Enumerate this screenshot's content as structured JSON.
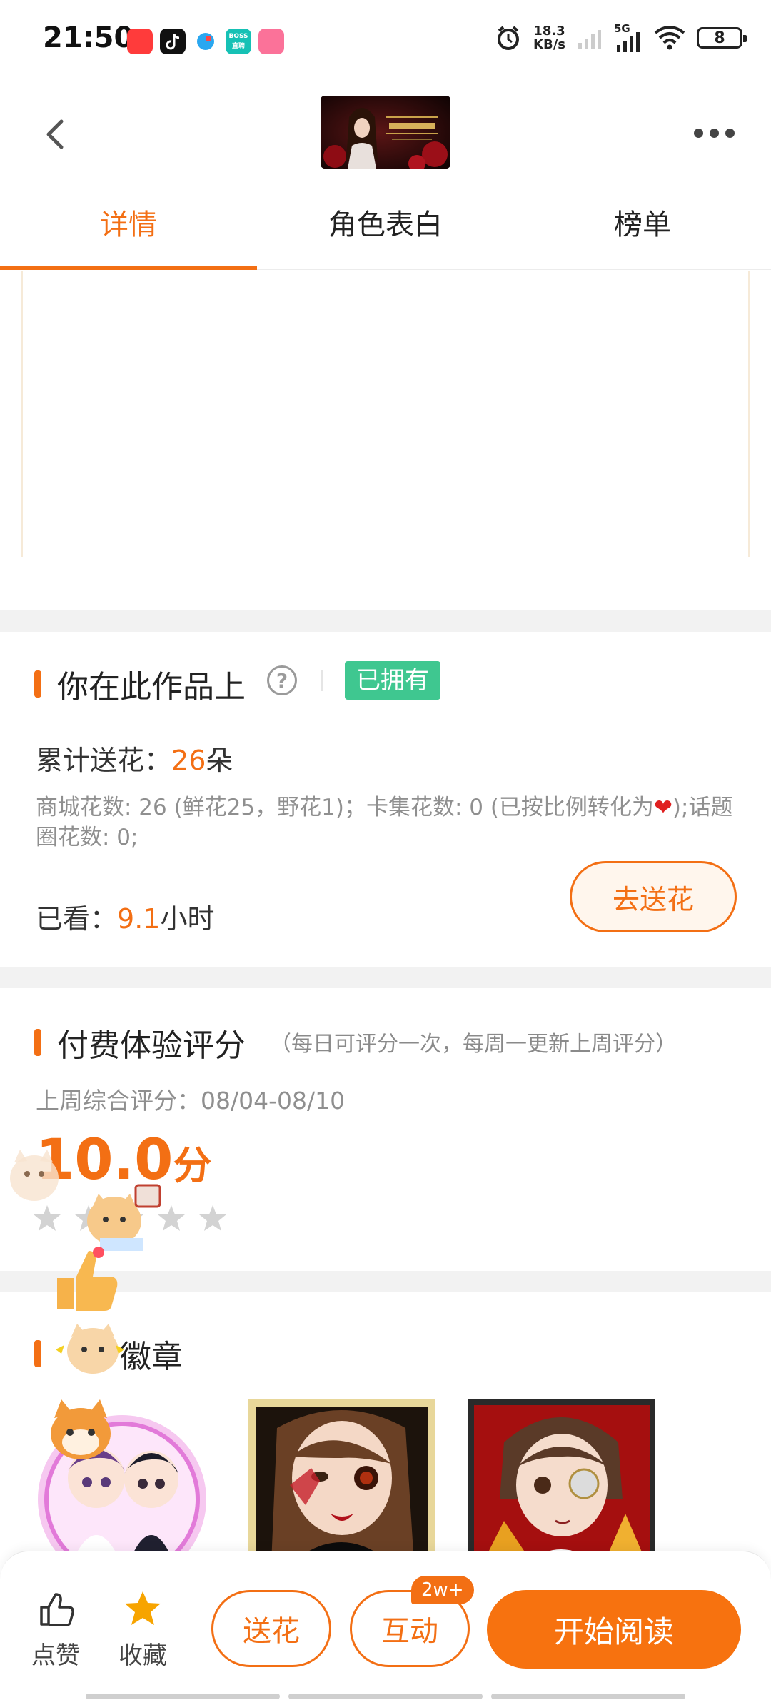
{
  "status_bar": {
    "time": "21:50",
    "net_speed_value": "18.3",
    "net_speed_unit": "KB/s",
    "network": "5G",
    "battery": "8",
    "app_icons": [
      "kuaikan-app-icon",
      "tiktok-app-icon",
      "bird-app-icon",
      "boss-zhipin-app-icon",
      "bilibili-app-icon"
    ],
    "boss_label": "BOSS\n直聘"
  },
  "header": {
    "back_icon": "chevron-left-icon",
    "more_icon": "more-dots-icon"
  },
  "tabs": [
    {
      "label": "详情",
      "active": true
    },
    {
      "label": "角色表白",
      "active": false
    },
    {
      "label": "榜单",
      "active": false
    }
  ],
  "ownership": {
    "title": "你在此作品上",
    "owned_badge": "已拥有",
    "total_flowers_label": "累计送花：",
    "total_flowers_value": "26",
    "total_flowers_unit": "朵",
    "flower_detail_part1": "商城花数: 26 (鲜花25，野花1)；卡集花数: 0 (已按比例转化为",
    "flower_detail_part2": ");话题圈花数: 0;",
    "watched_label": "已看：",
    "watched_value": "9.1",
    "watched_unit": "小时",
    "send_flower_button": "去送花"
  },
  "rating": {
    "title": "付费体验评分",
    "note": "（每日可评分一次，每周一更新上周评分）",
    "week_label": "上周综合评分：08/04-08/10",
    "score": "10.0",
    "score_unit": "分",
    "stars_filled": 0,
    "stars_total": 5
  },
  "badges": {
    "title": "作品徽章",
    "visible_title_fragment": "徽章"
  },
  "bottom_bar": {
    "like_label": "点赞",
    "favorite_label": "收藏",
    "flower_button": "送花",
    "interact_button": "互动",
    "interact_count": "2w+",
    "start_reading_button": "开始阅读"
  },
  "colors": {
    "accent": "#f36f14",
    "owned_badge": "#3fc790",
    "favorite_star": "#f7a400"
  }
}
